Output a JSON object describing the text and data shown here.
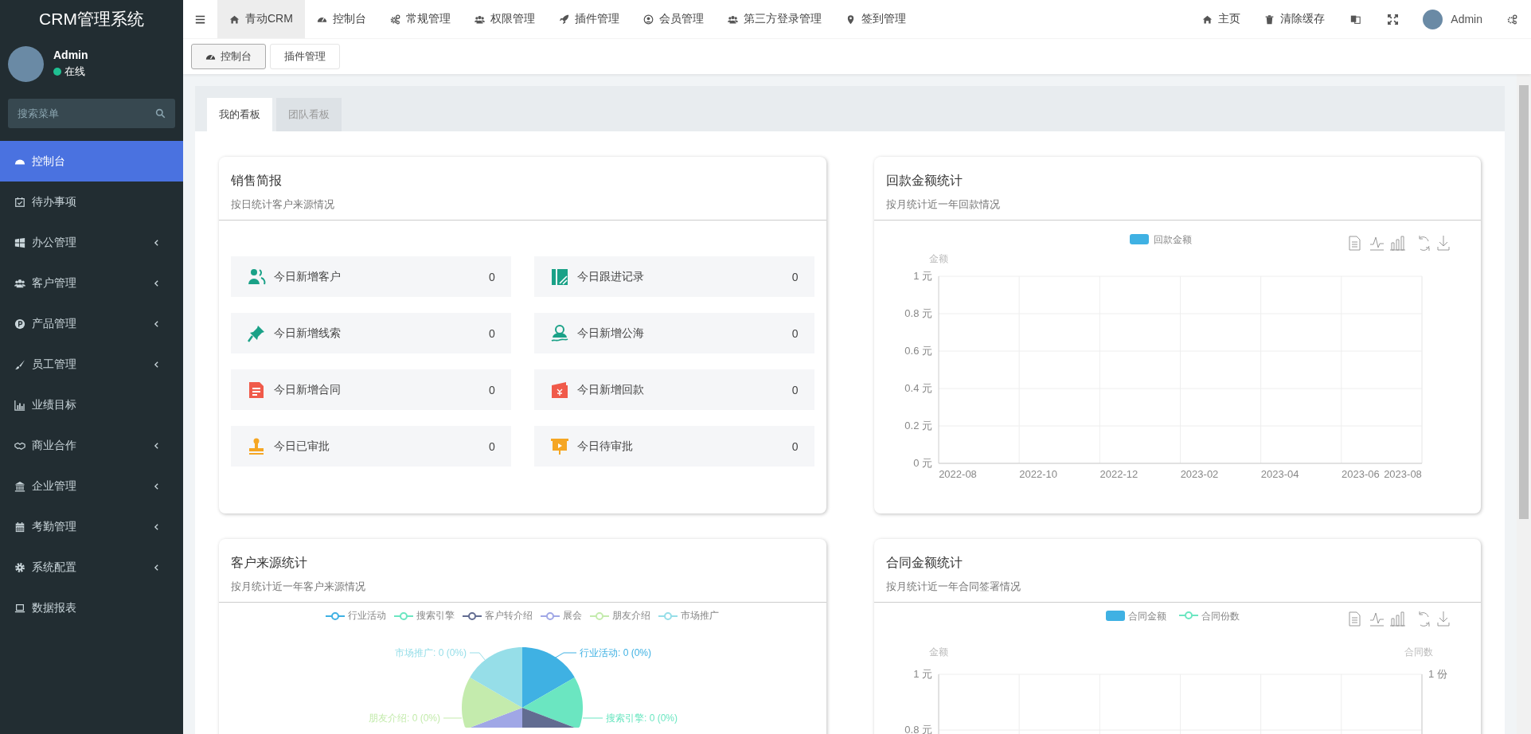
{
  "sidebar": {
    "title": "CRM管理系统",
    "user": {
      "name": "Admin",
      "status": "在线",
      "online": true
    },
    "search": {
      "placeholder": "搜索菜单"
    },
    "items": [
      {
        "label": "控制台",
        "selected": true,
        "expandable": false
      },
      {
        "label": "待办事项",
        "selected": false,
        "expandable": false
      },
      {
        "label": "办公管理",
        "selected": false,
        "expandable": true
      },
      {
        "label": "客户管理",
        "selected": false,
        "expandable": true
      },
      {
        "label": "产品管理",
        "selected": false,
        "expandable": true
      },
      {
        "label": "员工管理",
        "selected": false,
        "expandable": true
      },
      {
        "label": "业绩目标",
        "selected": false,
        "expandable": false
      },
      {
        "label": "商业合作",
        "selected": false,
        "expandable": true
      },
      {
        "label": "企业管理",
        "selected": false,
        "expandable": true
      },
      {
        "label": "考勤管理",
        "selected": false,
        "expandable": true
      },
      {
        "label": "系统配置",
        "selected": false,
        "expandable": true
      },
      {
        "label": "数据报表",
        "selected": false,
        "expandable": false
      }
    ]
  },
  "topbar": {
    "menu": [
      {
        "label": "青动CRM",
        "selected": true
      },
      {
        "label": "控制台",
        "selected": false
      },
      {
        "label": "常规管理",
        "selected": false
      },
      {
        "label": "权限管理",
        "selected": false
      },
      {
        "label": "插件管理",
        "selected": false
      },
      {
        "label": "会员管理",
        "selected": false
      },
      {
        "label": "第三方登录管理",
        "selected": false
      },
      {
        "label": "签到管理",
        "selected": false
      }
    ],
    "right": [
      {
        "label": "主页"
      },
      {
        "label": "清除缓存"
      }
    ],
    "user": {
      "name": "Admin"
    }
  },
  "page_tabs": [
    {
      "label": "控制台",
      "selected": true
    },
    {
      "label": "插件管理",
      "selected": false
    }
  ],
  "board_tabs": [
    {
      "label": "我的看板",
      "selected": true
    },
    {
      "label": "团队看板",
      "selected": false
    }
  ],
  "sales_report": {
    "title": "销售简报",
    "subtitle": "按日统计客户来源情况",
    "stats": [
      {
        "label": "今日新增客户",
        "value": "0"
      },
      {
        "label": "今日跟进记录",
        "value": "0"
      },
      {
        "label": "今日新增线索",
        "value": "0"
      },
      {
        "label": "今日新增公海",
        "value": "0"
      },
      {
        "label": "今日新增合同",
        "value": "0"
      },
      {
        "label": "今日新增回款",
        "value": "0"
      },
      {
        "label": "今日已审批",
        "value": "0"
      },
      {
        "label": "今日待审批",
        "value": "0"
      }
    ]
  },
  "payment_chart": {
    "title": "回款金额统计",
    "subtitle": "按月统计近一年回款情况",
    "chart_data": {
      "type": "bar",
      "ylabel": "金额",
      "categories": [
        "2022-08",
        "2022-10",
        "2022-12",
        "2023-02",
        "2023-04",
        "2023-06",
        "2023-08"
      ],
      "series": [
        {
          "name": "回款金额",
          "color": "#3fb1e3",
          "values": [
            0,
            0,
            0,
            0,
            0,
            0,
            0
          ]
        }
      ],
      "grid": true,
      "ylim": [
        0,
        1
      ],
      "yticks": [
        {
          "value": 0,
          "label": "0 元"
        },
        {
          "value": 0.2,
          "label": "0.2 元"
        },
        {
          "value": 0.4,
          "label": "0.4 元"
        },
        {
          "value": 0.6,
          "label": "0.6 元"
        },
        {
          "value": 0.8,
          "label": "0.8 元"
        },
        {
          "value": 1,
          "label": "1 元"
        }
      ]
    }
  },
  "source_chart": {
    "title": "客户来源统计",
    "subtitle": "按月统计近一年客户来源情况",
    "legend": [
      {
        "name": "行业活动",
        "color": "#3fb1e3"
      },
      {
        "name": "搜索引擎",
        "color": "#6be6c1"
      },
      {
        "name": "客户转介绍",
        "color": "#626c91"
      },
      {
        "name": "展会",
        "color": "#a0a7e6"
      },
      {
        "name": "朋友介绍",
        "color": "#c4ebad"
      },
      {
        "name": "市场推广",
        "color": "#96dee8"
      }
    ],
    "slice_labels": [
      "市场推广: 0 (0%)",
      "行业活动: 0 (0%)",
      "朋友介绍: 0 (0%)",
      "搜索引擎: 0 (0%)"
    ]
  },
  "contract_chart": {
    "title": "合同金额统计",
    "subtitle": "按月统计近一年合同签署情况",
    "legend": [
      {
        "name": "合同金额",
        "kind": "bar",
        "color": "#3fb1e3"
      },
      {
        "name": "合同份数",
        "kind": "line",
        "color": "#6be6c1"
      }
    ],
    "left_axis_name": "金额",
    "right_axis_name": "合同数",
    "left_ticks": [
      "1 元",
      "0.8 元"
    ],
    "right_ticks": [
      "1 份"
    ]
  }
}
